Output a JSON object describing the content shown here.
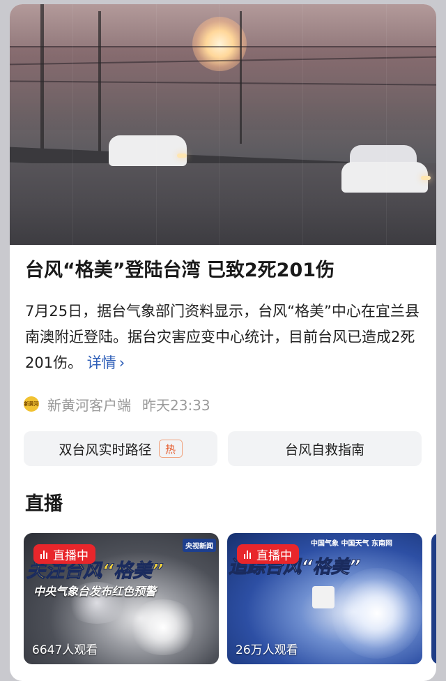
{
  "article": {
    "title": "台风“格美”登陆台湾 已致2死201伤",
    "summary": "7月25日，据台气象部门资料显示，台风“格美”中心在宜兰县南澳附近登陆。据台灾害应变中心统计，目前台风已造成2死201伤。",
    "more_label": "详情",
    "source_name": "新黄河客户端",
    "source_logo_text": "新黄河",
    "time": "昨天23:33"
  },
  "quick_links": [
    {
      "label": "双台风实时路径",
      "tag": "热"
    },
    {
      "label": "台风自救指南"
    }
  ],
  "live_section": {
    "title": "直播",
    "cards": [
      {
        "badge": "直播中",
        "banner_text": "关注台风“格美”",
        "subtitle": "中央气象台发布红色预警",
        "channel_tag": "央视新闻",
        "viewers": "6647人观看"
      },
      {
        "badge": "直播中",
        "banner_text": "追踪台风“格美”",
        "header_text": "中国气象  中国天气  东南网",
        "viewers": "26万人观看"
      }
    ]
  },
  "colors": {
    "link": "#2f5fb8",
    "live_badge": "#e8262b",
    "hot_tag": "#e55a2b",
    "pill_bg": "#f2f3f5"
  }
}
